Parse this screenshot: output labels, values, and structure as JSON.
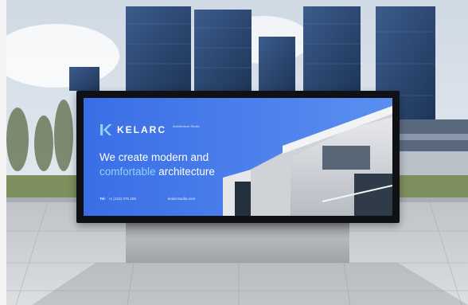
{
  "billboard": {
    "brand": "KELARC",
    "brand_sub": "Architecture Studio",
    "headline_line1": "We create modern and",
    "headline_accent": "comfortable",
    "headline_rest": " architecture",
    "tel_label": "Tel:",
    "tel_value": "+1 (123) 075 400",
    "website": "kelarcstudio.com"
  },
  "colors": {
    "panel_blue": "#3b6fe6",
    "accent": "#8fd2ff",
    "frame": "#0f1114",
    "sky": "#dfe6ee",
    "glass": "#2b4a78"
  },
  "icons": [
    "kelarc-logo-icon"
  ]
}
